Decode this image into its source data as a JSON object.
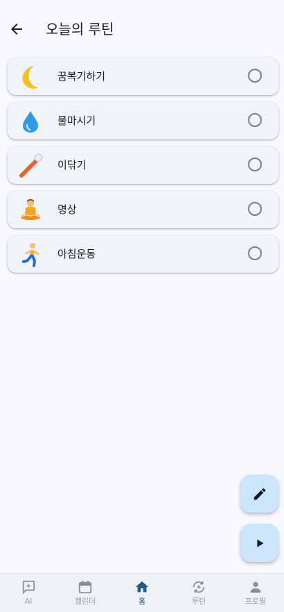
{
  "header": {
    "title": "오늘의 루틴"
  },
  "routines": [
    {
      "emoji": "moon",
      "label": "꿈복기하기",
      "checked": false
    },
    {
      "emoji": "droplet",
      "label": "물마시기",
      "checked": false
    },
    {
      "emoji": "toothbrush",
      "label": "이닦기",
      "checked": false
    },
    {
      "emoji": "meditation",
      "label": "명상",
      "checked": false
    },
    {
      "emoji": "runner",
      "label": "아침운동",
      "checked": false
    }
  ],
  "nav": {
    "items": [
      {
        "label": "AI",
        "icon": "ai-chat-icon"
      },
      {
        "label": "캘린더",
        "icon": "calendar-icon"
      },
      {
        "label": "홈",
        "icon": "home-icon",
        "active": true
      },
      {
        "label": "루틴",
        "icon": "routine-icon"
      },
      {
        "label": "프로필",
        "icon": "person-icon"
      }
    ]
  },
  "colors": {
    "background": "#f7f9fe",
    "card": "#f0f3f8",
    "fab": "#cde5fb",
    "active_nav": "#1e5a86",
    "inactive_nav": "#9a9da3"
  }
}
